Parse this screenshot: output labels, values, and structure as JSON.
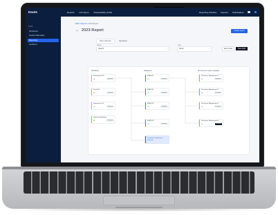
{
  "app": {
    "logo": "Doots",
    "nav": [
      "Reports",
      "Our layers",
      "Sustainability profile"
    ],
    "nav_right": [
      "Reporting interface",
      "Reports",
      "Notifications"
    ],
    "icons": [
      "help-icon",
      "settings-icon",
      "user-icon"
    ]
  },
  "sidebar": {
    "section": "DATA",
    "items": [
      {
        "label": "Workflows",
        "active": false
      },
      {
        "label": "Double Materiality",
        "active": false
      },
      {
        "label": "Reporting",
        "active": true
      },
      {
        "label": "Guidance",
        "active": false
      }
    ]
  },
  "page": {
    "breadcrumb": [
      "ESG",
      "Reports",
      "2023 Report"
    ],
    "title": "2023 Report",
    "primary_button": "Create report",
    "tabs": [
      "Data collection",
      "Narratives"
    ],
    "filter_label_1": "Scope",
    "filter_value_1": "Search",
    "filter_label_2": "Year",
    "filter_value_2": "Show",
    "button_secondary": "Export data",
    "button_dark": "Save draft"
  },
  "board": {
    "columns": [
      "Workflows",
      "Datapoints",
      "EU common report templates"
    ],
    "workflows": [
      {
        "title": "Environment E1",
        "meta": "0/8",
        "badge": "In progress"
      },
      {
        "title": "Social S1",
        "meta": "0/4",
        "badge": "In progress"
      },
      {
        "title": "Governance G1",
        "meta": "0/3",
        "badge": "In progress"
      },
      {
        "title": "General information",
        "meta": "0/6",
        "badge": "In progress"
      }
    ],
    "datapoints": [
      {
        "title": "ESRS E1",
        "meta": "0/2",
        "badge": "In progress"
      },
      {
        "title": "ESRS S1",
        "meta": "0/4",
        "badge": "In progress"
      },
      {
        "title": "ESRS G1",
        "meta": "0/3",
        "badge": "In progress"
      },
      {
        "title": "ESRS G2",
        "meta": "0/1",
        "badge": "In progress"
      }
    ],
    "highlight_card": "Disclosure requirement selected",
    "templates": [
      {
        "title": "Disclosure Requirement 1",
        "meta": "0/1",
        "badge": "In progress",
        "dark": false
      },
      {
        "title": "Disclosure Requirement 2",
        "meta": "0/2",
        "badge": "In progress",
        "dark": false
      },
      {
        "title": "Disclosure Requirement 3",
        "meta": "0/1",
        "badge": "In progress",
        "dark": false
      },
      {
        "title": "Disclosure Requirement 4",
        "meta": "0/1",
        "badge": "Submitted",
        "dark": true
      }
    ]
  },
  "colors": {
    "nav_bg": "#0b1e3e",
    "accent": "#2563eb",
    "workflow_bar": "#f5b400"
  }
}
